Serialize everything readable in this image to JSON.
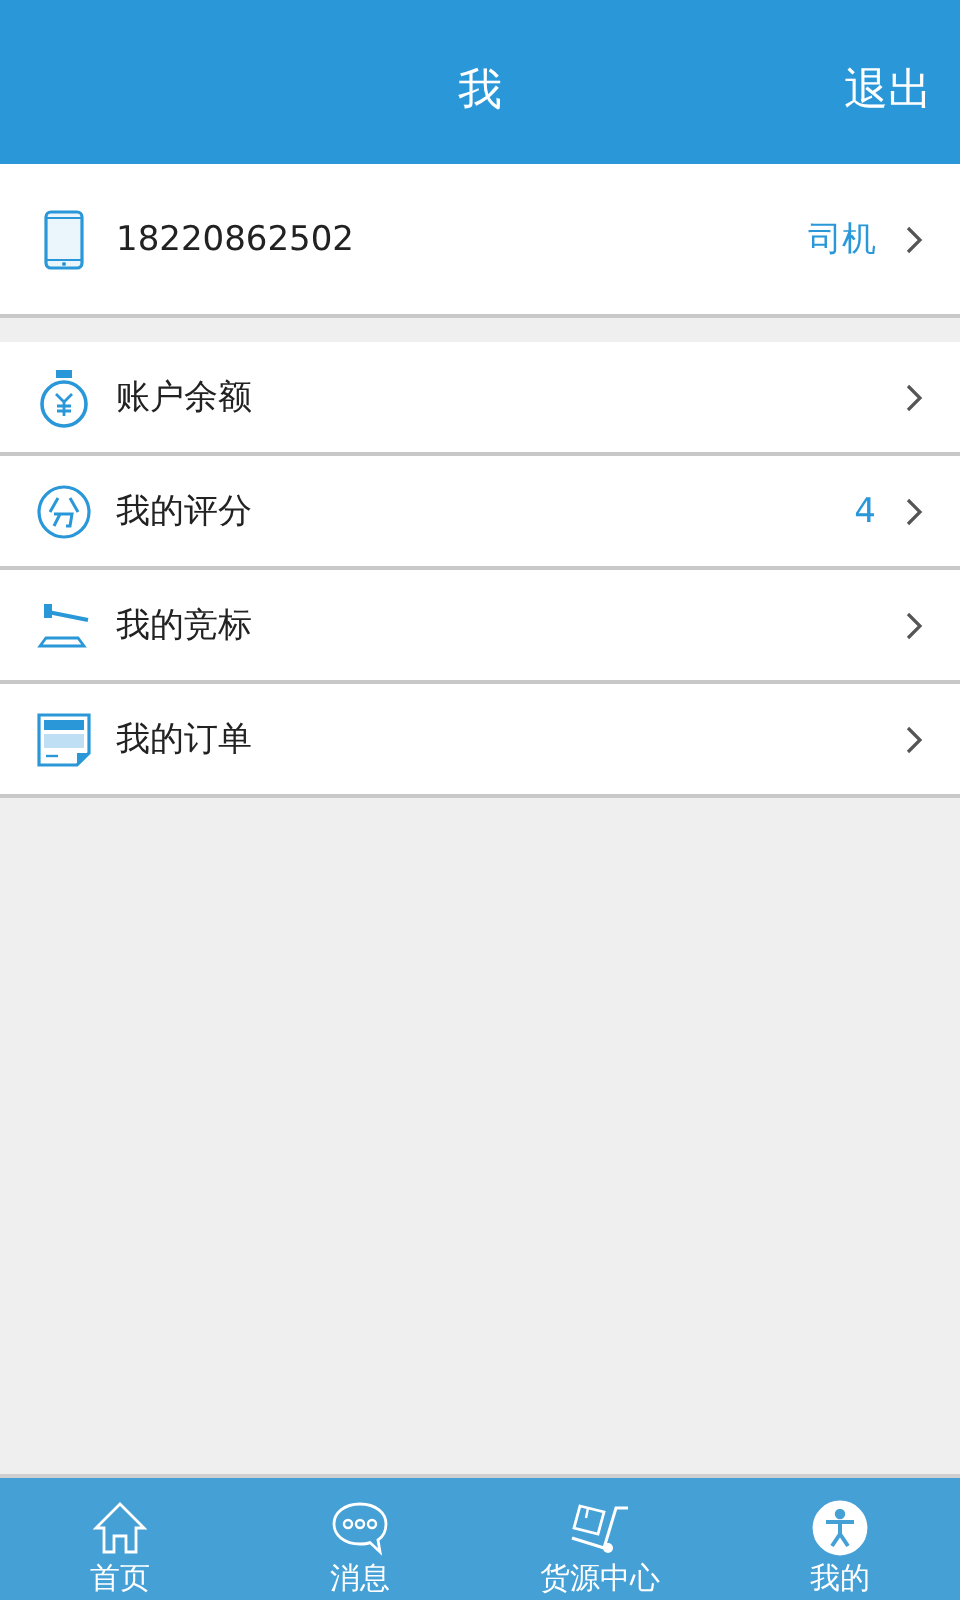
{
  "header": {
    "title": "我",
    "logout": "退出"
  },
  "profile": {
    "phone": "18220862502",
    "role": "司机"
  },
  "menu": [
    {
      "kind": "balance",
      "label": "账户余额"
    },
    {
      "kind": "rating",
      "label": "我的评分",
      "value": "4"
    },
    {
      "kind": "bid",
      "label": "我的竞标"
    },
    {
      "kind": "orders",
      "label": "我的订单"
    }
  ],
  "tabs": [
    {
      "kind": "home",
      "label": "首页",
      "selected": false
    },
    {
      "kind": "messages",
      "label": "消息",
      "selected": false
    },
    {
      "kind": "cargo",
      "label": "货源中心",
      "selected": false
    },
    {
      "kind": "me",
      "label": "我的",
      "selected": true
    }
  ]
}
